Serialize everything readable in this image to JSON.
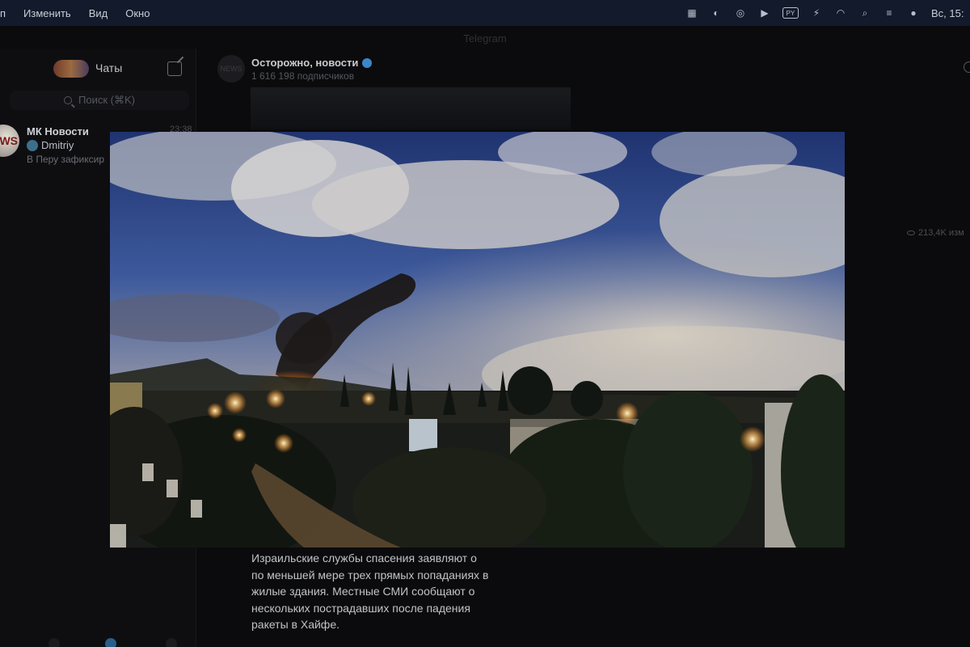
{
  "menubar": {
    "app_partial": "п",
    "items": [
      "Изменить",
      "Вид",
      "Окно"
    ],
    "clock": "Вс, 15:"
  },
  "window": {
    "title": "Telegram"
  },
  "sidebar": {
    "title": "Чаты",
    "search_placeholder": "Поиск (⌘K)",
    "chats": [
      {
        "name": "МК Новости",
        "time": "23:38",
        "sender": "Dmitriy",
        "preview": "В Перу зафиксир",
        "avatar_text": "WS"
      }
    ]
  },
  "channel": {
    "name": "Осторожно, новости",
    "subscribers": "1 616 198 подписчиков",
    "avatar_text": "NEWS"
  },
  "message": {
    "views": "213,4K изм",
    "text_lines": [
      "Израильские службы спасения заявляют о",
      "по меньшей мере трех прямых попаданиях в",
      "жилые здания. Местные СМИ сообщают о",
      "нескольких пострадавших после падения",
      "ракеты в Хайфе."
    ]
  },
  "colors": {
    "accent": "#3b87c9",
    "menubar_bg": "#131a2b",
    "window_bg": "#0b0b0d"
  }
}
